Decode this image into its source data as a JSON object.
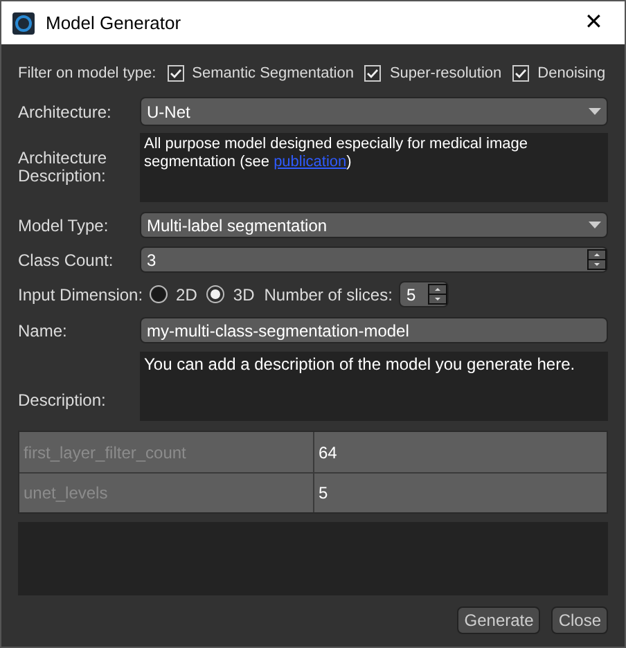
{
  "window": {
    "title": "Model Generator",
    "close": "✕"
  },
  "filter": {
    "label": "Filter on model type:",
    "options": [
      {
        "label": "Semantic Segmentation",
        "checked": true
      },
      {
        "label": "Super-resolution",
        "checked": true
      },
      {
        "label": "Denoising",
        "checked": true
      }
    ]
  },
  "architecture": {
    "label": "Architecture:",
    "value": "U-Net"
  },
  "architecture_description": {
    "label": "Architecture Description:",
    "text": "All purpose model designed especially for medical image segmentation (see ",
    "link": "publication",
    "after": ")"
  },
  "model_type": {
    "label": "Model Type:",
    "value": "Multi-label segmentation"
  },
  "class_count": {
    "label": "Class Count:",
    "value": "3"
  },
  "input_dimension": {
    "label": "Input Dimension:",
    "options": [
      {
        "label": "2D",
        "selected": false
      },
      {
        "label": "3D",
        "selected": true
      }
    ],
    "slices_label": "Number of slices:",
    "slices": "5"
  },
  "name": {
    "label": "Name:",
    "value": "my-multi-class-segmentation-model"
  },
  "description": {
    "label": "Description:",
    "value": "You can add a description of the model you generate here."
  },
  "parameters": [
    {
      "name": "first_layer_filter_count",
      "value": "64"
    },
    {
      "name": "unet_levels",
      "value": "5"
    }
  ],
  "buttons": [
    "Generate",
    "Close"
  ]
}
